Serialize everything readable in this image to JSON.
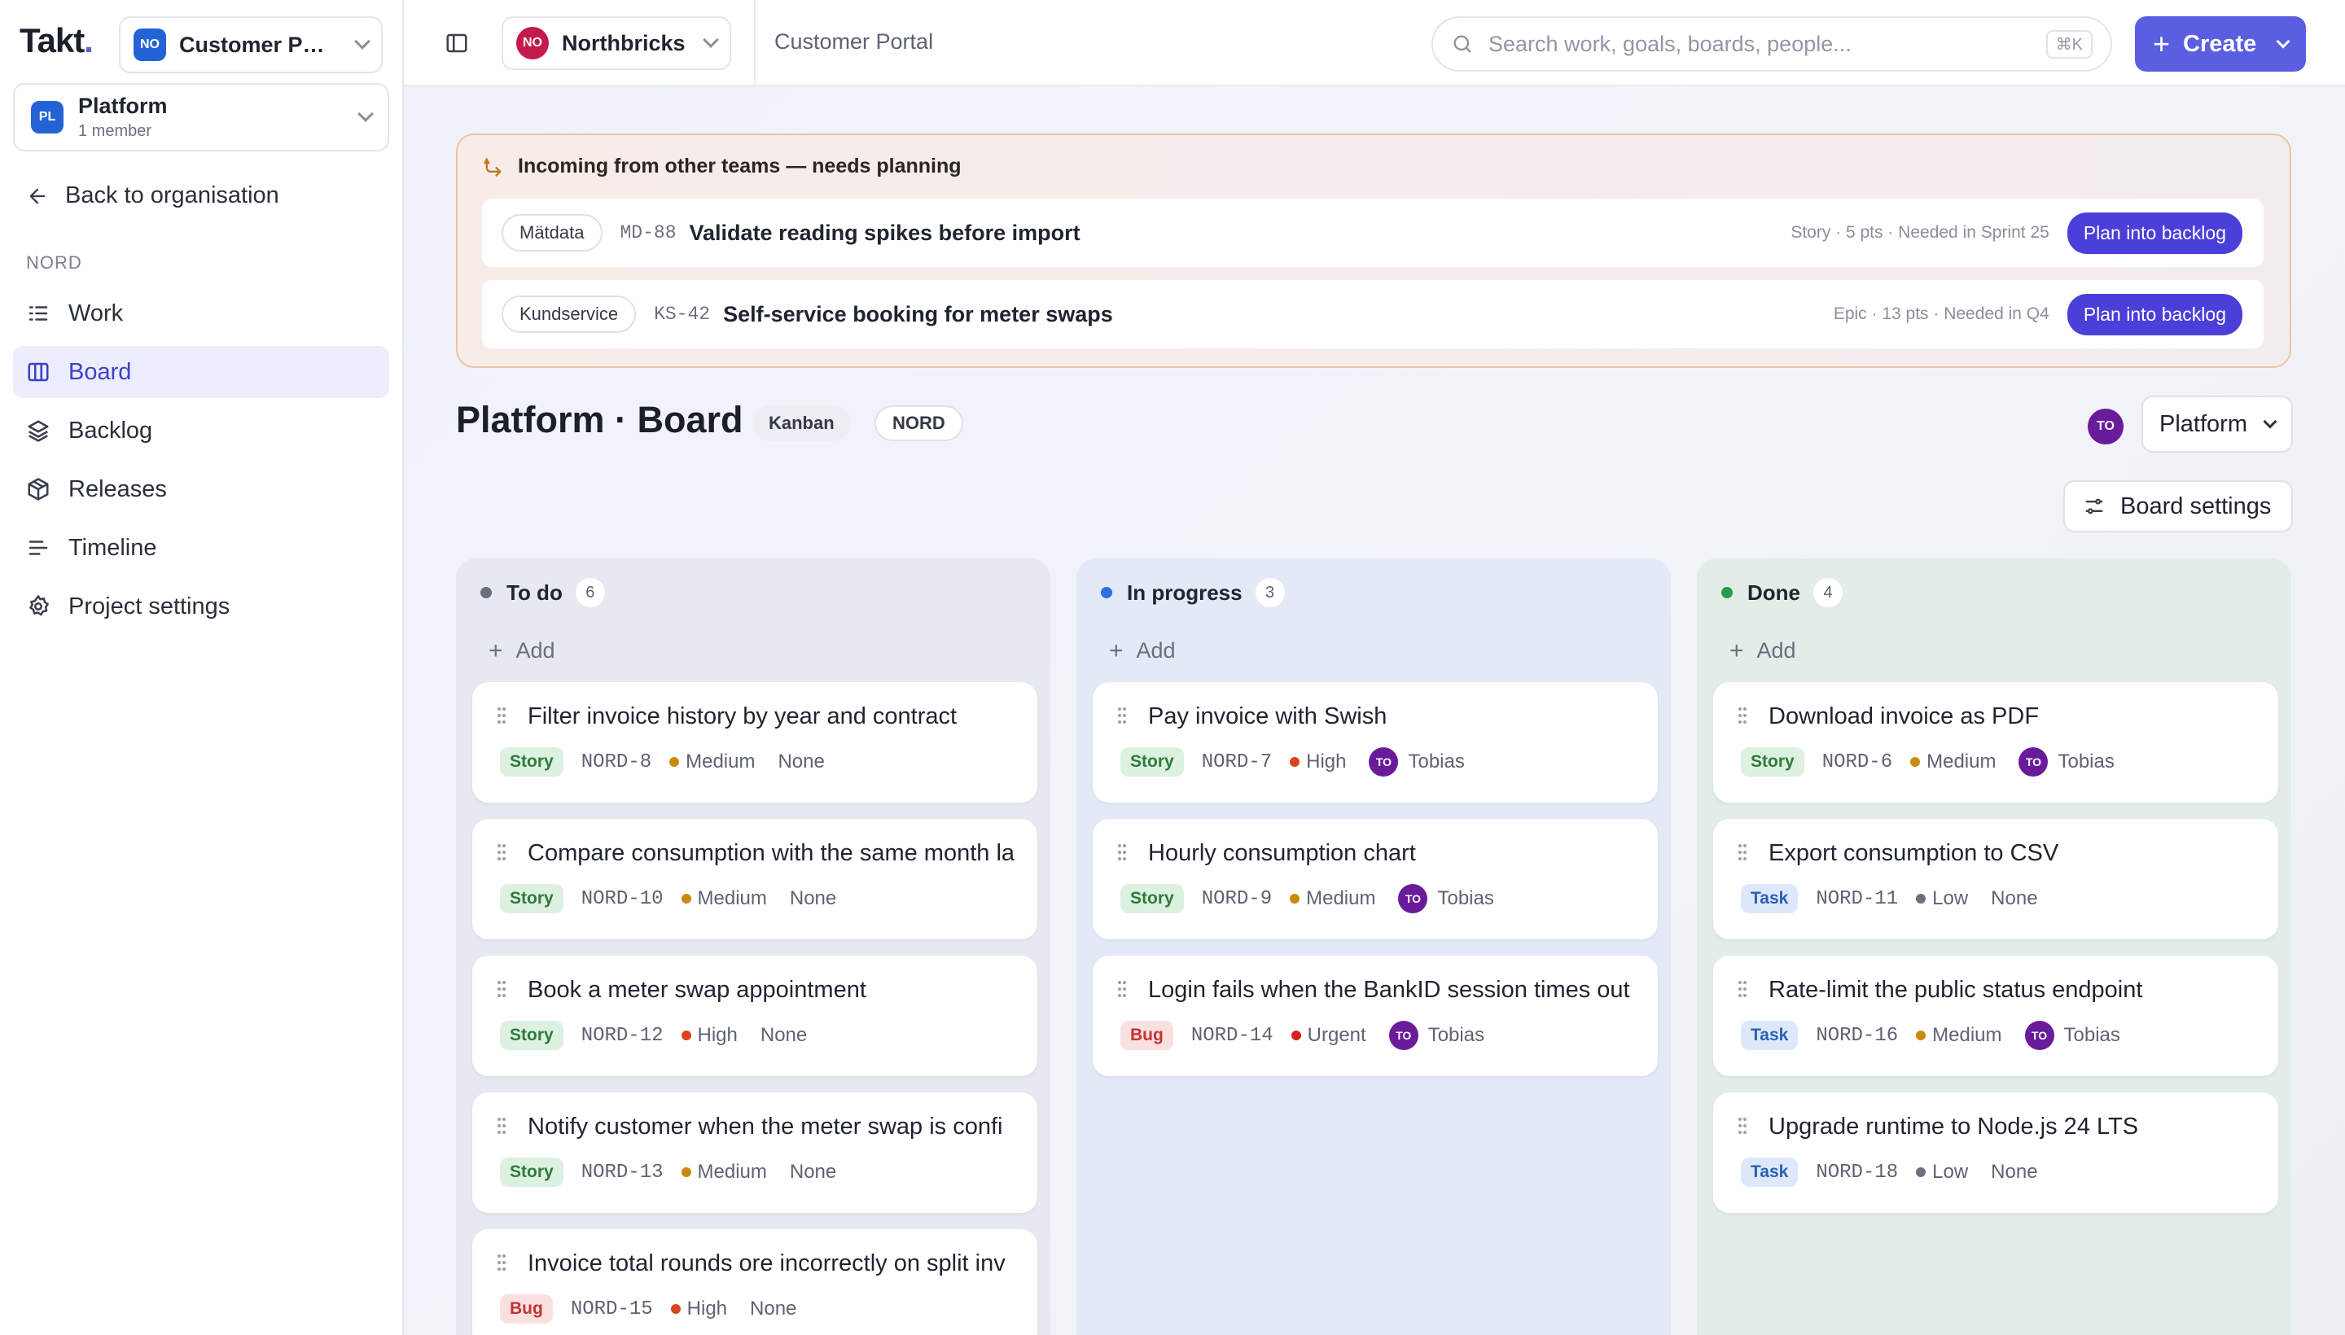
{
  "sidebar": {
    "logo": "Takt",
    "logo_dot": ".",
    "project_select": {
      "badge": "NO",
      "name": "Customer Po..."
    },
    "team_select": {
      "badge": "PL",
      "name": "Platform",
      "members": "1 member"
    },
    "back_label": "Back to organisation",
    "section_label": "NORD",
    "items": [
      {
        "label": "Work",
        "icon": "work-icon",
        "active": false
      },
      {
        "label": "Board",
        "icon": "board-icon",
        "active": true
      },
      {
        "label": "Backlog",
        "icon": "layers-icon",
        "active": false
      },
      {
        "label": "Releases",
        "icon": "package-icon",
        "active": false
      },
      {
        "label": "Timeline",
        "icon": "timeline-icon",
        "active": false
      },
      {
        "label": "Project settings",
        "icon": "gear-icon",
        "active": false
      }
    ]
  },
  "topbar": {
    "org": {
      "badge": "NO",
      "name": "Northbricks"
    },
    "breadcrumb": "Customer Portal",
    "search_placeholder": "Search work, goals, boards, people...",
    "search_shortcut": "⌘K",
    "create_label": "Create"
  },
  "incoming": {
    "title": "Incoming from other teams — needs planning",
    "rows": [
      {
        "team": "Mätdata",
        "key": "MD-88",
        "title": "Validate reading spikes before import",
        "meta": "Story · 5 pts · Needed in Sprint 25",
        "action": "Plan into backlog"
      },
      {
        "team": "Kundservice",
        "key": "KS-42",
        "title": "Self-service booking for meter swaps",
        "meta": "Epic · 13 pts · Needed in Q4",
        "action": "Plan into backlog"
      }
    ]
  },
  "board": {
    "title": "Platform · Board",
    "mode_pill": "Kanban",
    "project_pill": "NORD",
    "user_avatar": "TO",
    "team_dropdown": "Platform",
    "settings_label": "Board settings",
    "add_label": "Add",
    "columns": [
      {
        "name": "To do",
        "count": "6",
        "dot_color": "#6b7080",
        "cards": [
          {
            "title": "Filter invoice history by year and contract",
            "type": "Story",
            "key": "NORD-8",
            "priority": "Medium",
            "assignee": "None",
            "avatar": ""
          },
          {
            "title": "Compare consumption with the same month la",
            "type": "Story",
            "key": "NORD-10",
            "priority": "Medium",
            "assignee": "None",
            "avatar": ""
          },
          {
            "title": "Book a meter swap appointment",
            "type": "Story",
            "key": "NORD-12",
            "priority": "High",
            "assignee": "None",
            "avatar": ""
          },
          {
            "title": "Notify customer when the meter swap is confi",
            "type": "Story",
            "key": "NORD-13",
            "priority": "Medium",
            "assignee": "None",
            "avatar": ""
          },
          {
            "title": "Invoice total rounds ore incorrectly on split inv",
            "type": "Bug",
            "key": "NORD-15",
            "priority": "High",
            "assignee": "None",
            "avatar": ""
          }
        ]
      },
      {
        "name": "In progress",
        "count": "3",
        "dot_color": "#2f6fe0",
        "cards": [
          {
            "title": "Pay invoice with Swish",
            "type": "Story",
            "key": "NORD-7",
            "priority": "High",
            "assignee": "Tobias",
            "avatar": "TO"
          },
          {
            "title": "Hourly consumption chart",
            "type": "Story",
            "key": "NORD-9",
            "priority": "Medium",
            "assignee": "Tobias",
            "avatar": "TO"
          },
          {
            "title": "Login fails when the BankID session times out",
            "type": "Bug",
            "key": "NORD-14",
            "priority": "Urgent",
            "assignee": "Tobias",
            "avatar": "TO"
          }
        ]
      },
      {
        "name": "Done",
        "count": "4",
        "dot_color": "#2a9d4b",
        "cards": [
          {
            "title": "Download invoice as PDF",
            "type": "Story",
            "key": "NORD-6",
            "priority": "Medium",
            "assignee": "Tobias",
            "avatar": "TO"
          },
          {
            "title": "Export consumption to CSV",
            "type": "Task",
            "key": "NORD-11",
            "priority": "Low",
            "assignee": "None",
            "avatar": ""
          },
          {
            "title": "Rate-limit the public status endpoint",
            "type": "Task",
            "key": "NORD-16",
            "priority": "Medium",
            "assignee": "Tobias",
            "avatar": "TO"
          },
          {
            "title": "Upgrade runtime to Node.js 24 LTS",
            "type": "Task",
            "key": "NORD-18",
            "priority": "Low",
            "assignee": "None",
            "avatar": ""
          }
        ]
      }
    ]
  },
  "colors": {
    "accent": "#5a5ee0",
    "plan_button": "#4b3fd9",
    "priority_high": "#d9441c",
    "priority_medium": "#c98a12",
    "priority_low": "#6b7080",
    "priority_urgent": "#d6201f",
    "avatar": "#6a1b9a"
  }
}
